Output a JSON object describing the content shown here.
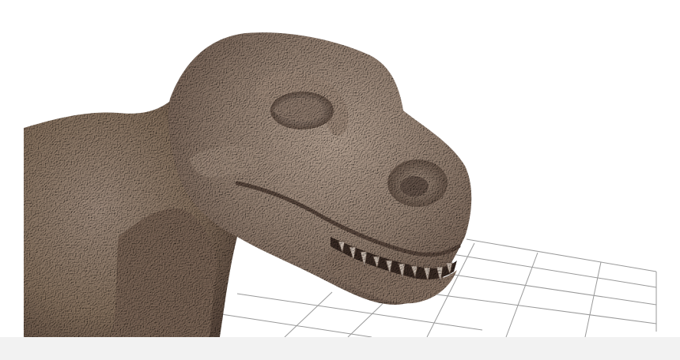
{
  "scene": {
    "subject_icon": "trex-sculpt-icon",
    "ground_icon": "perspective-grid-icon"
  },
  "colors": {
    "background": "#ffffff",
    "bottom_bar": "#f2f2f2",
    "clay_base": "#8c7667",
    "clay_light": "#b9a596",
    "clay_dark": "#4e3e35",
    "grid_line": "#9a9a9a",
    "teeth": "#cdbfb3"
  }
}
